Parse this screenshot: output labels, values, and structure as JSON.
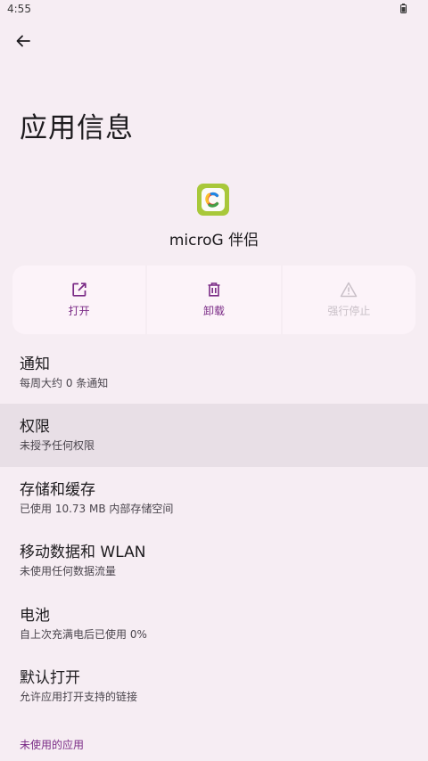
{
  "status_bar": {
    "time": "4:55"
  },
  "header": {
    "title": "应用信息"
  },
  "app": {
    "name": "microG 伴侣"
  },
  "actions": [
    {
      "label": "打开",
      "icon": "open-external-icon",
      "enabled": true
    },
    {
      "label": "卸载",
      "icon": "trash-icon",
      "enabled": true
    },
    {
      "label": "强行停止",
      "icon": "warning-icon",
      "enabled": false
    }
  ],
  "settings": [
    {
      "title": "通知",
      "subtitle": "每周大约 0 条通知"
    },
    {
      "title": "权限",
      "subtitle": "未授予任何权限"
    },
    {
      "title": "存储和缓存",
      "subtitle": "已使用 10.73 MB 内部存储空间"
    },
    {
      "title": "移动数据和 WLAN",
      "subtitle": "未使用任何数据流量"
    },
    {
      "title": "电池",
      "subtitle": "自上次充满电后已使用 0%"
    },
    {
      "title": "默认打开",
      "subtitle": "允许应用打开支持的链接"
    }
  ],
  "section": {
    "unused_apps": "未使用的应用"
  },
  "colors": {
    "background": "#f6edf3",
    "accent": "#7a2a86",
    "card": "#fcf3f9",
    "highlight": "#e8dfe6",
    "app_icon": "#a8c83a"
  }
}
